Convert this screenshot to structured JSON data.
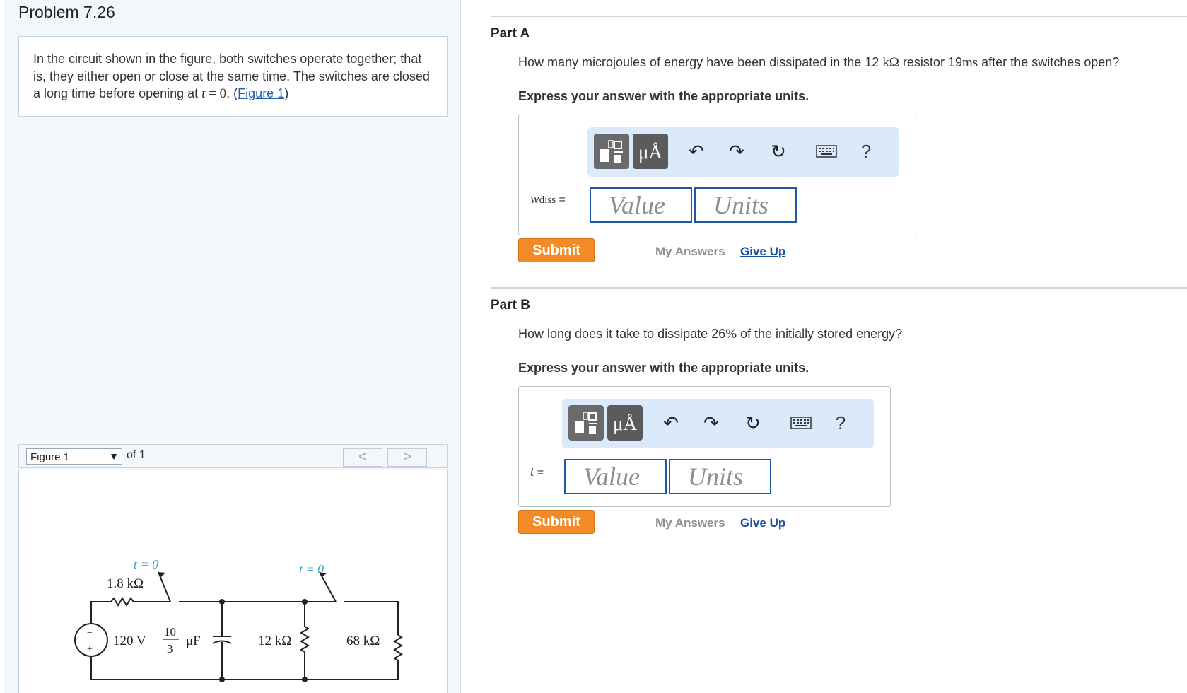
{
  "problem": {
    "title": "Problem 7.26",
    "text_1": "In the circuit shown in the figure, both switches operate together; that is, they either open or close at the same time. The switches are closed a long time before opening at ",
    "t_var": "t",
    "t_eq": " = 0",
    "text_2": ". (",
    "figure_link": "Figure 1",
    "text_3": ")"
  },
  "figure_nav": {
    "selected": "Figure 1",
    "of_label": "of 1",
    "prev": "<",
    "next": ">"
  },
  "circuit": {
    "switch_label_1": "t = 0",
    "switch_label_2": "t = 0",
    "r1": "1.8 kΩ",
    "source": "120 V",
    "cap_num": "10",
    "cap_den": "3",
    "cap_unit": "μF",
    "r2": "12 kΩ",
    "r3": "68 kΩ",
    "minus": "−",
    "plus": "+"
  },
  "part_a": {
    "label": "Part A",
    "q_1": "How many microjoules of energy have been dissipated in the 12 ",
    "q_unit": "kΩ",
    "q_2": " resistor 19",
    "q_ms": "ms",
    "q_3": " after the switches open?",
    "instruction": "Express your answer with the appropriate units.",
    "var": "w",
    "var_sub": "diss",
    "var_eq": " =",
    "value_placeholder": "Value",
    "units_placeholder": "Units",
    "submit": "Submit",
    "my_answers": "My Answers",
    "give_up": "Give Up"
  },
  "part_b": {
    "label": "Part B",
    "q_1": "How long does it take to dissipate 26",
    "q_pct": "%",
    "q_2": " of the initially stored energy?",
    "instruction": "Express your answer with the appropriate units.",
    "var": "t",
    "var_eq": " =",
    "value_placeholder": "Value",
    "units_placeholder": "Units",
    "submit": "Submit",
    "my_answers": "My Answers",
    "give_up": "Give Up"
  },
  "toolbar": {
    "units_symbol": "μÅ",
    "help": "?",
    "icons": [
      "templates-icon",
      "units-icon",
      "undo-icon",
      "redo-icon",
      "reset-icon",
      "keyboard-icon",
      "help-icon"
    ]
  }
}
